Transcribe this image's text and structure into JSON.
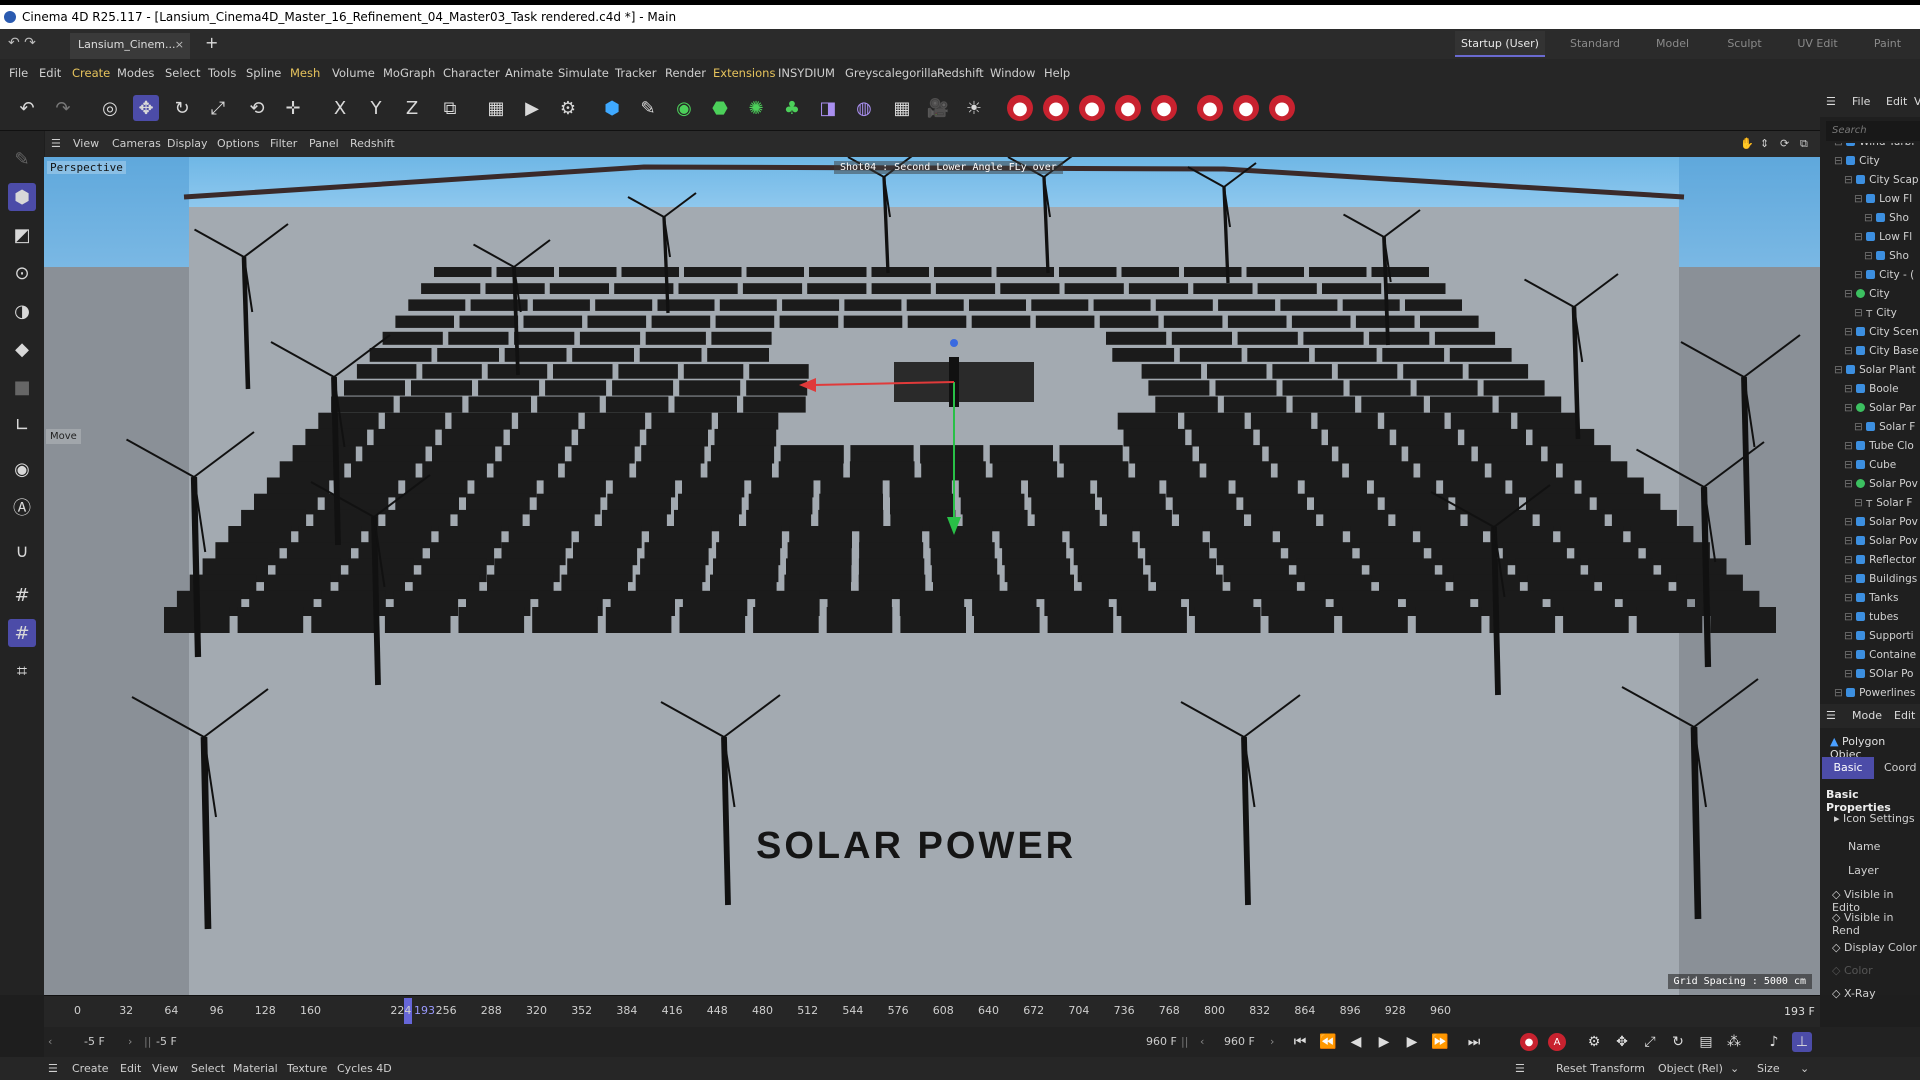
{
  "window": {
    "title": "Cinema 4D R25.117 - [Lansium_Cinema4D_Master_16_Refinement_04_Master03_Task rendered.c4d *] - Main"
  },
  "tabs": {
    "doc_tab": "Lansium_Cinem...",
    "close": "×",
    "add": "+"
  },
  "layouts": [
    "Startup (User)",
    "Standard",
    "Model",
    "Sculpt",
    "UV Edit",
    "Paint"
  ],
  "menu": [
    "File",
    "Edit",
    "Create",
    "Modes",
    "Select",
    "Tools",
    "Spline",
    "Mesh",
    "Volume",
    "MoGraph",
    "Character",
    "Animate",
    "Simulate",
    "Tracker",
    "Render",
    "Extensions",
    "INSYDIUM",
    "Greyscalegorilla",
    "Redshift",
    "Window",
    "Help"
  ],
  "toolbar": {
    "axis_x": "X",
    "axis_y": "Y",
    "axis_z": "Z"
  },
  "view_menu": [
    "View",
    "Cameras",
    "Display",
    "Options",
    "Filter",
    "Panel",
    "Redshift"
  ],
  "viewport": {
    "label": "Perspective",
    "camera": "Shot04 : Second Lower Angle FLy over",
    "tool_label": "Move",
    "grid_spacing": "Grid Spacing : 5000 cm",
    "scene_text": "SOLAR POWER"
  },
  "object_manager": {
    "menu": [
      "File",
      "Edit",
      "V"
    ],
    "search_placeholder": "Search",
    "items": [
      {
        "name": "Wind Turbi",
        "icon": "null-icon",
        "depth": 1
      },
      {
        "name": "City",
        "icon": "null-icon",
        "depth": 1
      },
      {
        "name": "City Scap",
        "icon": "null-icon",
        "depth": 2
      },
      {
        "name": "Low Fl",
        "icon": "null-icon",
        "depth": 3
      },
      {
        "name": "Sho",
        "icon": "polygon-icon",
        "depth": 4
      },
      {
        "name": "Low Fl",
        "icon": "null-icon",
        "depth": 3
      },
      {
        "name": "Sho",
        "icon": "polygon-icon",
        "depth": 4
      },
      {
        "name": "City - (",
        "icon": "polygon-icon",
        "depth": 3
      },
      {
        "name": "City",
        "icon": "generator-icon",
        "depth": 2
      },
      {
        "name": "City",
        "icon": "text-icon",
        "depth": 3
      },
      {
        "name": "City Scen",
        "icon": "null-icon",
        "depth": 2
      },
      {
        "name": "City Base",
        "icon": "polygon-icon",
        "depth": 2
      },
      {
        "name": "Solar Plant",
        "icon": "null-icon",
        "depth": 1
      },
      {
        "name": "Boole",
        "icon": "polygon-icon",
        "depth": 2
      },
      {
        "name": "Solar Par",
        "icon": "generator-icon",
        "depth": 2
      },
      {
        "name": "Solar F",
        "icon": "polygon-icon",
        "depth": 3
      },
      {
        "name": "Tube Clo",
        "icon": "polygon-icon",
        "depth": 2
      },
      {
        "name": "Cube",
        "icon": "polygon-icon",
        "depth": 2
      },
      {
        "name": "Solar Pov",
        "icon": "generator-icon",
        "depth": 2
      },
      {
        "name": "Solar F",
        "icon": "text-icon",
        "depth": 3
      },
      {
        "name": "Solar Pov",
        "icon": "null-icon",
        "depth": 2
      },
      {
        "name": "Solar Pov",
        "icon": "polygon-icon",
        "depth": 2
      },
      {
        "name": "Reflector",
        "icon": "null-icon",
        "depth": 2
      },
      {
        "name": "Buildings",
        "icon": "null-icon",
        "depth": 2
      },
      {
        "name": "Tanks",
        "icon": "null-icon",
        "depth": 2
      },
      {
        "name": "tubes",
        "icon": "null-icon",
        "depth": 2
      },
      {
        "name": "Supporti",
        "icon": "null-icon",
        "depth": 2
      },
      {
        "name": "Containe",
        "icon": "null-icon",
        "depth": 2
      },
      {
        "name": "SOlar Po",
        "icon": "polygon-icon",
        "depth": 2
      },
      {
        "name": "Powerlines",
        "icon": "null-icon",
        "depth": 1
      }
    ]
  },
  "attributes": {
    "menu": [
      "Mode",
      "Edit"
    ],
    "object_type": "Polygon Objec",
    "tabs": [
      "Basic",
      "Coord"
    ],
    "section": "Basic Properties",
    "subsection": "Icon Settings",
    "fields": [
      "Name",
      "Layer",
      "Visible in Edito",
      "Visible in Rend",
      "Display Color",
      "Color",
      "X-Ray"
    ]
  },
  "timeline": {
    "ticks": [
      "0",
      "32",
      "64",
      "96",
      "128",
      "160",
      "193",
      "224",
      "256",
      "288",
      "320",
      "352",
      "384",
      "416",
      "448",
      "480",
      "512",
      "544",
      "576",
      "608",
      "640",
      "672",
      "704",
      "736",
      "768",
      "800",
      "832",
      "864",
      "896",
      "928",
      "960"
    ],
    "current_frame": "193",
    "end_frame": "193 F"
  },
  "transport": {
    "start": "-5 F",
    "start2": "-5 F",
    "end": "960 F",
    "end2": "960 F"
  },
  "bottom": {
    "menu": [
      "Create",
      "Edit",
      "View",
      "Select",
      "Material",
      "Texture",
      "Cycles 4D"
    ],
    "reset": "Reset Transform",
    "coord_mode": "Object (Rel)",
    "size_mode": "Size"
  }
}
